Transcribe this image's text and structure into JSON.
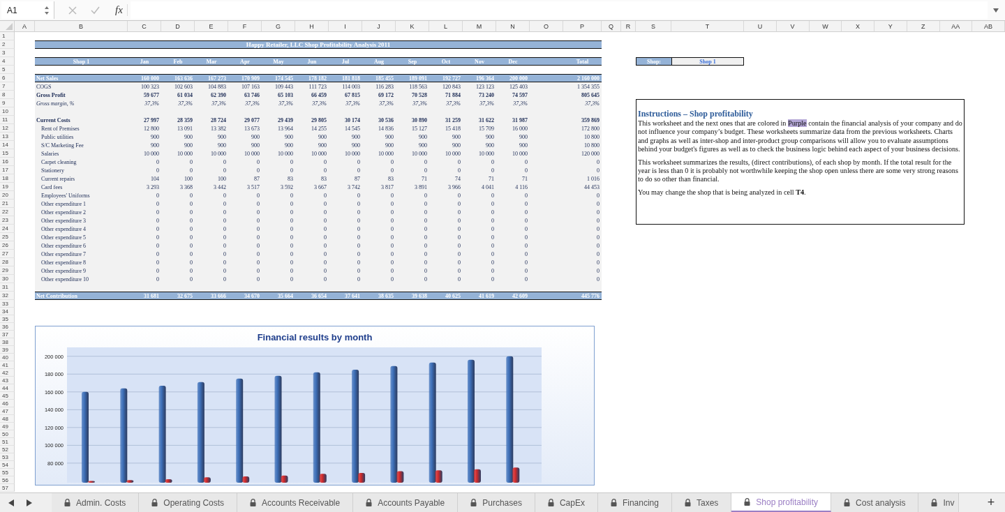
{
  "name_box": {
    "value": "A1"
  },
  "formula_bar": {
    "function_label": "fx"
  },
  "column_headers": [
    "A",
    "B",
    "C",
    "D",
    "E",
    "F",
    "G",
    "H",
    "I",
    "J",
    "K",
    "L",
    "M",
    "N",
    "O",
    "P",
    "Q",
    "R",
    "S",
    "T",
    "U",
    "V",
    "W",
    "X",
    "Y",
    "Z",
    "AA",
    "AB"
  ],
  "row_headers": [
    "1",
    "2",
    "3",
    "4",
    "5",
    "6",
    "7",
    "8",
    "9",
    "10",
    "11",
    "12",
    "13",
    "14",
    "15",
    "16",
    "17",
    "18",
    "19",
    "20",
    "21",
    "22",
    "23",
    "24",
    "25",
    "26",
    "27",
    "28",
    "29",
    "30",
    "31",
    "32",
    "33",
    "34",
    "35",
    "36",
    "37",
    "38",
    "39",
    "40",
    "41",
    "42",
    "43",
    "44",
    "45",
    "46",
    "47",
    "48",
    "49",
    "50",
    "51",
    "52",
    "53",
    "54",
    "55",
    "56",
    "57"
  ],
  "table": {
    "title": "Happy Retailer, LLC Shop Profitability Analysis 2011",
    "header": {
      "label": "Shop 1",
      "months": [
        "Jan",
        "Feb",
        "Mar",
        "Apr",
        "May",
        "Jun",
        "Jul",
        "Aug",
        "Sep",
        "Oct",
        "Nov",
        "Dec"
      ],
      "total": "Total"
    },
    "sections": [
      {
        "rows": [
          {
            "label": "Net Sales",
            "kind": "band",
            "values": [
              "160 000",
              "163 636",
              "167 273",
              "170 909",
              "174 545",
              "178 182",
              "181 818",
              "185 455",
              "189 091",
              "192 727",
              "196 364",
              "200 000"
            ],
            "total": "2 160 000"
          },
          {
            "label": "COGS",
            "kind": "normal",
            "values": [
              "100 323",
              "102 603",
              "104 883",
              "107 163",
              "109 443",
              "111 723",
              "114 003",
              "116 283",
              "118 563",
              "120 843",
              "123 123",
              "125 403"
            ],
            "total": "1 354 355"
          },
          {
            "label": "Gross Profit",
            "kind": "bold",
            "values": [
              "59 677",
              "61 034",
              "62 390",
              "63 746",
              "65 103",
              "66 459",
              "67 815",
              "69 172",
              "70 528",
              "71 884",
              "73 240",
              "74 597"
            ],
            "total": "805 645"
          },
          {
            "label": "Gross margin, %",
            "kind": "italic",
            "values": [
              "37,3%",
              "37,3%",
              "37,3%",
              "37,3%",
              "37,3%",
              "37,3%",
              "37,3%",
              "37,3%",
              "37,3%",
              "37,3%",
              "37,3%",
              "37,3%"
            ],
            "total": "37,3%"
          }
        ]
      },
      {
        "rows": [
          {
            "label": "Current Costs",
            "kind": "bold",
            "values": [
              "27 997",
              "28 359",
              "28 724",
              "29 077",
              "29 439",
              "29 805",
              "30 174",
              "30 536",
              "30 890",
              "31 259",
              "31 622",
              "31 987"
            ],
            "total": "359 869"
          },
          {
            "label": "Rent of Premises",
            "kind": "indent",
            "values": [
              "12 800",
              "13 091",
              "13 382",
              "13 673",
              "13 964",
              "14 255",
              "14 545",
              "14 836",
              "15 127",
              "15 418",
              "15 709",
              "16 000"
            ],
            "total": "172 800"
          },
          {
            "label": "Public utilities",
            "kind": "indent",
            "values": [
              "900",
              "900",
              "900",
              "900",
              "900",
              "900",
              "900",
              "900",
              "900",
              "900",
              "900",
              "900"
            ],
            "total": "10 800"
          },
          {
            "label": "S/C Marketing Fee",
            "kind": "indent",
            "values": [
              "900",
              "900",
              "900",
              "900",
              "900",
              "900",
              "900",
              "900",
              "900",
              "900",
              "900",
              "900"
            ],
            "total": "10 800"
          },
          {
            "label": "Salaries",
            "kind": "indent",
            "values": [
              "10 000",
              "10 000",
              "10 000",
              "10 000",
              "10 000",
              "10 000",
              "10 000",
              "10 000",
              "10 000",
              "10 000",
              "10 000",
              "10 000"
            ],
            "total": "120 000"
          },
          {
            "label": "Carpet cleaning",
            "kind": "indent",
            "values": [
              "0",
              "0",
              "0",
              "0",
              "0",
              "0",
              "0",
              "0",
              "0",
              "0",
              "0",
              "0"
            ],
            "total": "0"
          },
          {
            "label": "Stationery",
            "kind": "indent",
            "values": [
              "0",
              "0",
              "0",
              "0",
              "0",
              "0",
              "0",
              "0",
              "0",
              "0",
              "0",
              "0"
            ],
            "total": "0"
          },
          {
            "label": "Current repairs",
            "kind": "indent",
            "values": [
              "104",
              "100",
              "100",
              "87",
              "83",
              "83",
              "87",
              "83",
              "71",
              "74",
              "71",
              "71"
            ],
            "total": "1 016"
          },
          {
            "label": "Card fees",
            "kind": "indent",
            "values": [
              "3 293",
              "3 368",
              "3 442",
              "3 517",
              "3 592",
              "3 667",
              "3 742",
              "3 817",
              "3 891",
              "3 966",
              "4 041",
              "4 116"
            ],
            "total": "44 453"
          },
          {
            "label": "Employees' Uniforms",
            "kind": "indent",
            "values": [
              "0",
              "0",
              "0",
              "0",
              "0",
              "0",
              "0",
              "0",
              "0",
              "0",
              "0",
              "0"
            ],
            "total": "0"
          },
          {
            "label": "Other expenditure 1",
            "kind": "indent",
            "values": [
              "0",
              "0",
              "0",
              "0",
              "0",
              "0",
              "0",
              "0",
              "0",
              "0",
              "0",
              "0"
            ],
            "total": "0"
          },
          {
            "label": "Other expenditure 2",
            "kind": "indent",
            "values": [
              "0",
              "0",
              "0",
              "0",
              "0",
              "0",
              "0",
              "0",
              "0",
              "0",
              "0",
              "0"
            ],
            "total": "0"
          },
          {
            "label": "Other expenditure 3",
            "kind": "indent",
            "values": [
              "0",
              "0",
              "0",
              "0",
              "0",
              "0",
              "0",
              "0",
              "0",
              "0",
              "0",
              "0"
            ],
            "total": "0"
          },
          {
            "label": "Other expenditure 4",
            "kind": "indent",
            "values": [
              "0",
              "0",
              "0",
              "0",
              "0",
              "0",
              "0",
              "0",
              "0",
              "0",
              "0",
              "0"
            ],
            "total": "0"
          },
          {
            "label": "Other expenditure 5",
            "kind": "indent",
            "values": [
              "0",
              "0",
              "0",
              "0",
              "0",
              "0",
              "0",
              "0",
              "0",
              "0",
              "0",
              "0"
            ],
            "total": "0"
          },
          {
            "label": "Other expenditure 6",
            "kind": "indent",
            "values": [
              "0",
              "0",
              "0",
              "0",
              "0",
              "0",
              "0",
              "0",
              "0",
              "0",
              "0",
              "0"
            ],
            "total": "0"
          },
          {
            "label": "Other expenditure 7",
            "kind": "indent",
            "values": [
              "0",
              "0",
              "0",
              "0",
              "0",
              "0",
              "0",
              "0",
              "0",
              "0",
              "0",
              "0"
            ],
            "total": "0"
          },
          {
            "label": "Other expenditure 8",
            "kind": "indent",
            "values": [
              "0",
              "0",
              "0",
              "0",
              "0",
              "0",
              "0",
              "0",
              "0",
              "0",
              "0",
              "0"
            ],
            "total": "0"
          },
          {
            "label": "Other expenditure 9",
            "kind": "indent",
            "values": [
              "0",
              "0",
              "0",
              "0",
              "0",
              "0",
              "0",
              "0",
              "0",
              "0",
              "0",
              "0"
            ],
            "total": "0"
          },
          {
            "label": "Other expenditure 10",
            "kind": "indent",
            "values": [
              "0",
              "0",
              "0",
              "0",
              "0",
              "0",
              "0",
              "0",
              "0",
              "0",
              "0",
              "0"
            ],
            "total": "0"
          }
        ]
      },
      {
        "rows": [
          {
            "label": "Net Contribution",
            "kind": "band",
            "values": [
              "31 681",
              "32 675",
              "33 666",
              "34 670",
              "35 664",
              "36 654",
              "37 641",
              "38 635",
              "39 638",
              "40 625",
              "41 619",
              "42 609"
            ],
            "total": "445 776"
          }
        ]
      }
    ]
  },
  "shop_selector": {
    "label": "Shop:",
    "value": "Shop 1"
  },
  "instructions": {
    "title": "Instructions – Shop profitability",
    "paragraphs": [
      {
        "parts": [
          {
            "text": "This worksheet and the next ones that are colored in ",
            "highlight": false
          },
          {
            "text": "Purple",
            "highlight": true
          },
          {
            "text": " contain the financial analysis of your company and do not influence your company’s budget. These worksheets summarize data from the previous worksheets. Charts and graphs as well as inter-shop and inter-product group comparisons will allow you to evaluate assumptions behind your budget's figures as well as to check the business logic behind each aspect of your business decisions.",
            "highlight": false
          }
        ]
      },
      {
        "parts": [
          {
            "text": "This worksheet summarizes the results, (direct contributions), of each shop by month. If the total result for the year is less than 0 it is probably not worthwhile keeping the shop open unless there are some very strong reasons to do so other than financial.",
            "highlight": false
          }
        ]
      },
      {
        "parts": [
          {
            "text": "You may change the shop that is being analyzed in cell **T4**.",
            "highlight": false
          }
        ]
      }
    ]
  },
  "chart": {
    "chart_data": {
      "type": "bar",
      "title": "Financial results by month",
      "ylim": [
        58000,
        210000
      ],
      "grid": true,
      "yticks": [
        {
          "value": 80000,
          "label": "80 000"
        },
        {
          "value": 100000,
          "label": "100 000"
        },
        {
          "value": 120000,
          "label": "120 000"
        },
        {
          "value": 140000,
          "label": "140 000"
        },
        {
          "value": 160000,
          "label": "160 000"
        },
        {
          "value": 180000,
          "label": "180 000"
        },
        {
          "value": 200000,
          "label": "200 000"
        }
      ],
      "series": [
        {
          "color": "#3d6fb8",
          "values": [
            160000,
            164000,
            167000,
            171000,
            175000,
            178000,
            182000,
            185000,
            189000,
            193000,
            196000,
            200000
          ]
        },
        {
          "color": "#d62a2a",
          "values": [
            60000,
            61000,
            62000,
            64000,
            65000,
            66000,
            68000,
            69000,
            71000,
            72000,
            73000,
            75000
          ]
        }
      ]
    }
  },
  "sheet_tabs": [
    {
      "label": "Admin. Costs",
      "selected": false
    },
    {
      "label": "Operating Costs",
      "selected": false
    },
    {
      "label": "Accounts Receivable",
      "selected": false
    },
    {
      "label": "Accounts Payable",
      "selected": false
    },
    {
      "label": "Purchases",
      "selected": false
    },
    {
      "label": "CapEx",
      "selected": false
    },
    {
      "label": "Financing",
      "selected": false
    },
    {
      "label": "Taxes",
      "selected": false
    },
    {
      "label": "Shop profitability",
      "selected": true
    },
    {
      "label": "Cost analysis",
      "selected": false
    },
    {
      "label": "Inv",
      "selected": false
    }
  ],
  "add_sheet": {
    "label": "+"
  }
}
